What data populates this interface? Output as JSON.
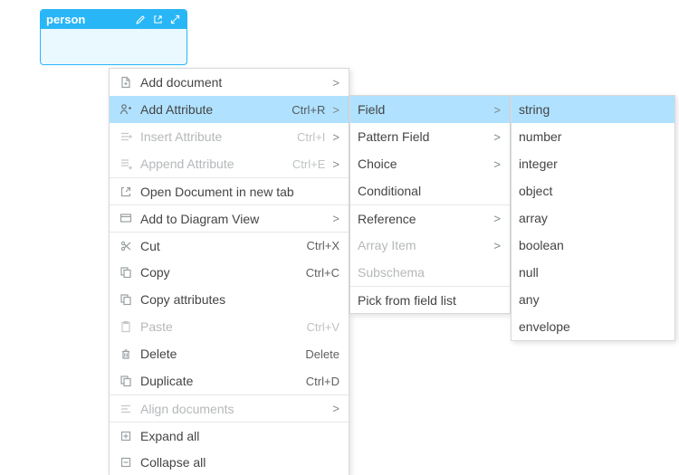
{
  "entity": {
    "title": "person"
  },
  "menu1": {
    "add_document": "Add document",
    "add_attribute": "Add Attribute",
    "add_attribute_short": "Ctrl+R",
    "insert_attribute": "Insert Attribute",
    "insert_attribute_short": "Ctrl+I",
    "append_attribute": "Append Attribute",
    "append_attribute_short": "Ctrl+E",
    "open_new_tab": "Open Document in new tab",
    "add_diagram": "Add to Diagram View",
    "cut": "Cut",
    "cut_short": "Ctrl+X",
    "copy": "Copy",
    "copy_short": "Ctrl+C",
    "copy_attrs": "Copy attributes",
    "paste": "Paste",
    "paste_short": "Ctrl+V",
    "delete": "Delete",
    "delete_short": "Delete",
    "duplicate": "Duplicate",
    "duplicate_short": "Ctrl+D",
    "align": "Align documents",
    "expand": "Expand all",
    "collapse": "Collapse all"
  },
  "menu2": {
    "field": "Field",
    "pattern_field": "Pattern Field",
    "choice": "Choice",
    "conditional": "Conditional",
    "reference": "Reference",
    "array_item": "Array Item",
    "subschema": "Subschema",
    "pick": "Pick from field list"
  },
  "menu3": {
    "string": "string",
    "number": "number",
    "integer": "integer",
    "object": "object",
    "array": "array",
    "boolean": "boolean",
    "null": "null",
    "any": "any",
    "envelope": "envelope"
  },
  "glyphs": {
    "submenu": ">"
  }
}
